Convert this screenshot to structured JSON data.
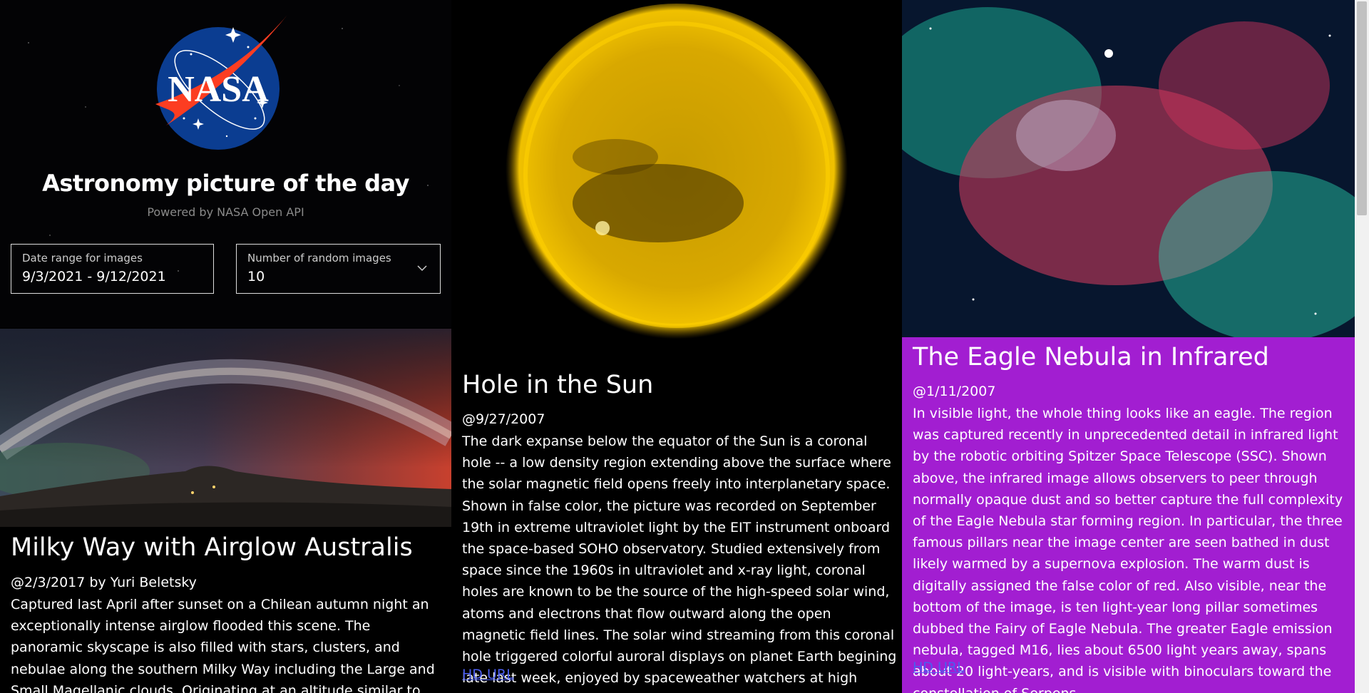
{
  "header": {
    "logo_text": "NASA",
    "title": "Astronomy picture of the day",
    "subtitle": "Powered by NASA Open API"
  },
  "controls": {
    "date_range": {
      "label": "Date range for images",
      "value": "9/3/2021 - 9/12/2021"
    },
    "count": {
      "label": "Number of random images",
      "value": "10",
      "icon": "chevron-down-icon"
    }
  },
  "cards": [
    {
      "title": "Milky Way with Airglow Australis",
      "meta": "@2/3/2017 by Yuri Beletsky",
      "description": "Captured last April after sunset on a Chilean autumn night an exceptionally intense airglow flooded this scene. The panoramic skyscape is also filled with stars, clusters, and nebulae along the southern Milky Way including the Large and Small Magellanic clouds. Originating at an altitude similar to aurorae, the luminous airglow is due"
    },
    {
      "title": "Hole in the Sun",
      "meta": "@9/27/2007",
      "description": "The dark expanse below the equator of the Sun is a coronal hole -- a low density region extending above the surface where the solar magnetic field opens freely into interplanetary space. Shown in false color, the picture was recorded on September 19th in extreme ultraviolet light by the EIT instrument onboard the space-based SOHO observatory. Studied extensively from space since the 1960s in ultraviolet and x-ray light, coronal holes are known to be the source of the high-speed solar wind, atoms and electrons that flow outward along the open magnetic field lines. The solar wind streaming from this coronal hole triggered colorful auroral displays on planet Earth begining late last week, enjoyed by spaceweather watchers at high latitudes.",
      "link": "HD URL"
    },
    {
      "title": "The Eagle Nebula in Infrared",
      "meta": "@1/11/2007",
      "description": "In visible light, the whole thing looks like an eagle. The region was captured recently in unprecedented detail in infrared light by the robotic orbiting Spitzer Space Telescope (SSC). Shown above, the infrared image allows observers to peer through normally opaque dust and so better capture the full complexity of the Eagle Nebula star forming region. In particular, the three famous pillars near the image center are seen bathed in dust likely warmed by a supernova explosion. The warm dust is digitally assigned the false color of red. Also visible, near the bottom of the image, is ten light-year long pillar sometimes dubbed the Fairy of Eagle Nebula. The greater Eagle emission nebula, tagged M16, lies about 6500 light years away, spans about 20 light-years, and is visible with binoculars toward the constellation of Serpens.",
      "link": "HD URL"
    }
  ],
  "colors": {
    "background": "#000000",
    "card3_background": "#a21ed1",
    "link": "#4b5ef0",
    "subtitle": "#8a8a8a"
  }
}
